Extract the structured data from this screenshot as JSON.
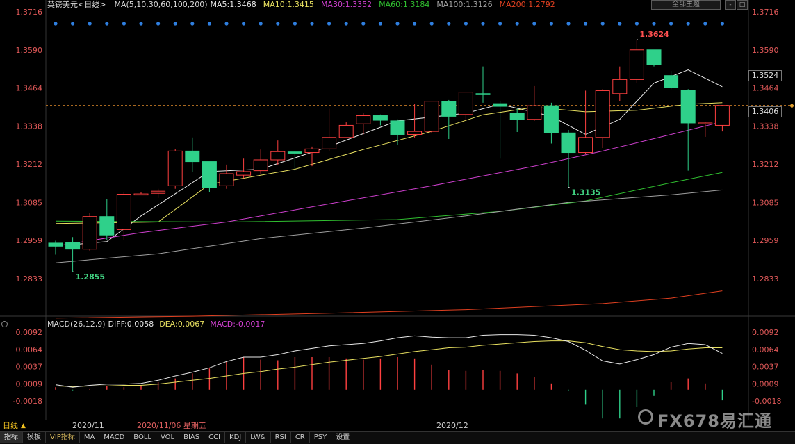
{
  "header": {
    "symbol": "英镑美元<日线>",
    "ma_params": "MA(5,10,30,60,100,200)",
    "ma5": "MA5:1.3468",
    "ma10": "MA10:1.3415",
    "ma30": "MA30:1.3352",
    "ma60": "MA60:1.3184",
    "ma100": "MA100:1.3126",
    "ma200": "MA200:1.2792",
    "theme_button": "全部主题",
    "win_buttons": [
      "-",
      "□",
      "×"
    ]
  },
  "colors": {
    "up": "#ff4040",
    "down": "#2fd08a",
    "ma5": "#e8e8e8",
    "ma10": "#e8e060",
    "ma30": "#d040d0",
    "ma60": "#30c030",
    "ma100": "#a0a0a0",
    "ma200": "#e04020",
    "axis_up": "#ff6060",
    "axis_down": "#40d080"
  },
  "price_axis": {
    "left_ticks": [
      "1.3716",
      "1.3590",
      "1.3464",
      "1.3338",
      "1.3212",
      "1.3085",
      "1.2959",
      "1.2833"
    ],
    "right_ticks": [
      "1.3716",
      "1.3590",
      "1.3464",
      "1.3338",
      "1.3212",
      "1.3085",
      "1.2959",
      "1.2833"
    ],
    "right_boxes": [
      "1.3524",
      "1.3406"
    ]
  },
  "annotations": {
    "high": "1.3624",
    "mid_low": "1.3135",
    "low": "1.2855"
  },
  "macd": {
    "params": "MACD(26,12,9)",
    "diff": "DIFF:0.0058",
    "dea": "DEA:0.0067",
    "macd": "MACD:-0.0017",
    "ticks": [
      "0.0092",
      "0.0064",
      "0.0037",
      "0.0009",
      "-0.0018"
    ]
  },
  "x_axis": {
    "period": "日线",
    "labels": [
      "2020/11",
      "2020/12"
    ],
    "cursor_label": "2020/11/06 星期五"
  },
  "toolbar": {
    "items": [
      "指标",
      "模板",
      "VIP指标",
      "MA",
      "MACD",
      "BOLL",
      "VOL",
      "BIAS",
      "CCI",
      "KDJ",
      "LW&",
      "RSI",
      "CR",
      "PSY",
      "设置"
    ]
  },
  "watermark": "FX678易汇通",
  "chart_data": {
    "type": "candlestick",
    "ylim": [
      1.277,
      1.3716
    ],
    "candles": [
      {
        "o": 1.295,
        "h": 1.2958,
        "l": 1.2912,
        "c": 1.294
      },
      {
        "o": 1.2951,
        "h": 1.297,
        "l": 1.2855,
        "c": 1.293
      },
      {
        "o": 1.293,
        "h": 1.305,
        "l": 1.2925,
        "c": 1.3038
      },
      {
        "o": 1.3038,
        "h": 1.3097,
        "l": 1.296,
        "c": 1.2977
      },
      {
        "o": 1.2995,
        "h": 1.312,
        "l": 1.296,
        "c": 1.3112
      },
      {
        "o": 1.3112,
        "h": 1.3118,
        "l": 1.311,
        "c": 1.3113
      },
      {
        "o": 1.3115,
        "h": 1.313,
        "l": 1.31,
        "c": 1.3122
      },
      {
        "o": 1.314,
        "h": 1.3262,
        "l": 1.313,
        "c": 1.3255
      },
      {
        "o": 1.3255,
        "h": 1.33,
        "l": 1.3185,
        "c": 1.322
      },
      {
        "o": 1.322,
        "h": 1.322,
        "l": 1.312,
        "c": 1.3135
      },
      {
        "o": 1.314,
        "h": 1.321,
        "l": 1.313,
        "c": 1.318
      },
      {
        "o": 1.3175,
        "h": 1.323,
        "l": 1.3165,
        "c": 1.3187
      },
      {
        "o": 1.319,
        "h": 1.326,
        "l": 1.318,
        "c": 1.3226
      },
      {
        "o": 1.3226,
        "h": 1.329,
        "l": 1.321,
        "c": 1.3253
      },
      {
        "o": 1.3252,
        "h": 1.3255,
        "l": 1.319,
        "c": 1.3248
      },
      {
        "o": 1.325,
        "h": 1.327,
        "l": 1.3205,
        "c": 1.3262
      },
      {
        "o": 1.3262,
        "h": 1.3395,
        "l": 1.3255,
        "c": 1.33
      },
      {
        "o": 1.33,
        "h": 1.335,
        "l": 1.3298,
        "c": 1.334
      },
      {
        "o": 1.3345,
        "h": 1.338,
        "l": 1.331,
        "c": 1.3372
      },
      {
        "o": 1.3372,
        "h": 1.3376,
        "l": 1.334,
        "c": 1.3357
      },
      {
        "o": 1.3355,
        "h": 1.336,
        "l": 1.3275,
        "c": 1.331
      },
      {
        "o": 1.331,
        "h": 1.341,
        "l": 1.33,
        "c": 1.332
      },
      {
        "o": 1.332,
        "h": 1.342,
        "l": 1.3315,
        "c": 1.342
      },
      {
        "o": 1.342,
        "h": 1.3424,
        "l": 1.3295,
        "c": 1.337
      },
      {
        "o": 1.3376,
        "h": 1.345,
        "l": 1.3355,
        "c": 1.345
      },
      {
        "o": 1.3445,
        "h": 1.3535,
        "l": 1.3415,
        "c": 1.3442
      },
      {
        "o": 1.3412,
        "h": 1.342,
        "l": 1.323,
        "c": 1.3403
      },
      {
        "o": 1.338,
        "h": 1.3395,
        "l": 1.3318,
        "c": 1.336
      },
      {
        "o": 1.336,
        "h": 1.347,
        "l": 1.3355,
        "c": 1.3405
      },
      {
        "o": 1.3405,
        "h": 1.3415,
        "l": 1.328,
        "c": 1.3315
      },
      {
        "o": 1.3315,
        "h": 1.3325,
        "l": 1.3135,
        "c": 1.325
      },
      {
        "o": 1.325,
        "h": 1.3455,
        "l": 1.3245,
        "c": 1.33
      },
      {
        "o": 1.33,
        "h": 1.346,
        "l": 1.3265,
        "c": 1.3455
      },
      {
        "o": 1.3445,
        "h": 1.3535,
        "l": 1.342,
        "c": 1.3492
      },
      {
        "o": 1.3492,
        "h": 1.3624,
        "l": 1.348,
        "c": 1.359
      },
      {
        "o": 1.359,
        "h": 1.359,
        "l": 1.3535,
        "c": 1.354
      },
      {
        "o": 1.3505,
        "h": 1.352,
        "l": 1.346,
        "c": 1.3465
      },
      {
        "o": 1.3456,
        "h": 1.346,
        "l": 1.319,
        "c": 1.3348
      },
      {
        "o": 1.3348,
        "h": 1.335,
        "l": 1.3302,
        "c": 1.3348
      },
      {
        "o": 1.334,
        "h": 1.3406,
        "l": 1.332,
        "c": 1.3406
      }
    ],
    "ma_series": [
      {
        "key": "ma5",
        "points": [
          [
            1,
            1.2945
          ],
          [
            3,
            1.2955
          ],
          [
            5,
            1.304
          ],
          [
            9,
            1.3187
          ],
          [
            12,
            1.3195
          ],
          [
            16,
            1.327
          ],
          [
            20,
            1.3355
          ],
          [
            24,
            1.338
          ],
          [
            26,
            1.341
          ],
          [
            29,
            1.337
          ],
          [
            31,
            1.331
          ],
          [
            33,
            1.336
          ],
          [
            35,
            1.348
          ],
          [
            37,
            1.3524
          ],
          [
            39,
            1.3468
          ]
        ]
      },
      {
        "key": "ma10",
        "points": [
          [
            0,
            1.3015
          ],
          [
            6,
            1.302
          ],
          [
            9,
            1.3145
          ],
          [
            14,
            1.3195
          ],
          [
            18,
            1.326
          ],
          [
            22,
            1.332
          ],
          [
            25,
            1.3375
          ],
          [
            28,
            1.34
          ],
          [
            31,
            1.3385
          ],
          [
            34,
            1.339
          ],
          [
            37,
            1.341
          ],
          [
            39,
            1.3415
          ]
        ]
      },
      {
        "key": "ma30",
        "points": [
          [
            0,
            1.294
          ],
          [
            5,
            1.2985
          ],
          [
            10,
            1.302
          ],
          [
            16,
            1.308
          ],
          [
            22,
            1.314
          ],
          [
            28,
            1.3205
          ],
          [
            32,
            1.3255
          ],
          [
            36,
            1.331
          ],
          [
            39,
            1.3352
          ]
        ]
      },
      {
        "key": "ma60",
        "points": [
          [
            0,
            1.3023
          ],
          [
            10,
            1.302
          ],
          [
            20,
            1.3028
          ],
          [
            26,
            1.3055
          ],
          [
            31,
            1.309
          ],
          [
            36,
            1.315
          ],
          [
            39,
            1.3184
          ]
        ]
      },
      {
        "key": "ma100",
        "points": [
          [
            0,
            1.2885
          ],
          [
            6,
            1.2915
          ],
          [
            12,
            1.2965
          ],
          [
            18,
            1.3
          ],
          [
            24,
            1.304
          ],
          [
            30,
            1.3085
          ],
          [
            36,
            1.311
          ],
          [
            39,
            1.3126
          ]
        ]
      },
      {
        "key": "ma200",
        "points": [
          [
            0,
            1.2702
          ],
          [
            8,
            1.2708
          ],
          [
            16,
            1.2718
          ],
          [
            24,
            1.273
          ],
          [
            32,
            1.275
          ],
          [
            36,
            1.2768
          ],
          [
            39,
            1.2792
          ]
        ]
      }
    ],
    "macd": {
      "ylim": [
        -0.0035,
        0.0105
      ],
      "diff": [
        0.0008,
        0.0004,
        0.0007,
        0.0009,
        0.0009,
        0.001,
        0.0015,
        0.0022,
        0.0028,
        0.0035,
        0.0045,
        0.0052,
        0.0052,
        0.0056,
        0.0062,
        0.0066,
        0.007,
        0.0072,
        0.0074,
        0.0078,
        0.0083,
        0.0086,
        0.0084,
        0.0083,
        0.0083,
        0.0087,
        0.0088,
        0.0088,
        0.0087,
        0.0083,
        0.0077,
        0.0063,
        0.0046,
        0.0041,
        0.0048,
        0.0056,
        0.0068,
        0.0074,
        0.0072,
        0.0058
      ],
      "dea": [
        0.0006,
        0.0005,
        0.0006,
        0.0006,
        0.0007,
        0.0007,
        0.0009,
        0.0012,
        0.0015,
        0.0018,
        0.0022,
        0.0026,
        0.0029,
        0.0033,
        0.0036,
        0.004,
        0.0044,
        0.0047,
        0.005,
        0.0053,
        0.0057,
        0.0061,
        0.0064,
        0.0067,
        0.0068,
        0.0071,
        0.0073,
        0.0075,
        0.0077,
        0.0078,
        0.0078,
        0.0075,
        0.0069,
        0.0064,
        0.0062,
        0.0061,
        0.0062,
        0.0065,
        0.0067,
        0.0067
      ],
      "hist": [
        0.0004,
        -0.0002,
        0.0001,
        0.0006,
        0.0004,
        0.0006,
        0.0012,
        0.0018,
        0.0026,
        0.0034,
        0.0045,
        0.0052,
        0.0048,
        0.0047,
        0.0052,
        0.0052,
        0.0052,
        0.005,
        0.0048,
        0.005,
        0.0052,
        0.005,
        0.004,
        0.0032,
        0.003,
        0.0032,
        0.003,
        0.0026,
        0.002,
        0.001,
        -0.0002,
        -0.0024,
        -0.0046,
        -0.0046,
        -0.0028,
        -0.001,
        0.0012,
        0.0018,
        0.001,
        -0.0017
      ]
    }
  }
}
